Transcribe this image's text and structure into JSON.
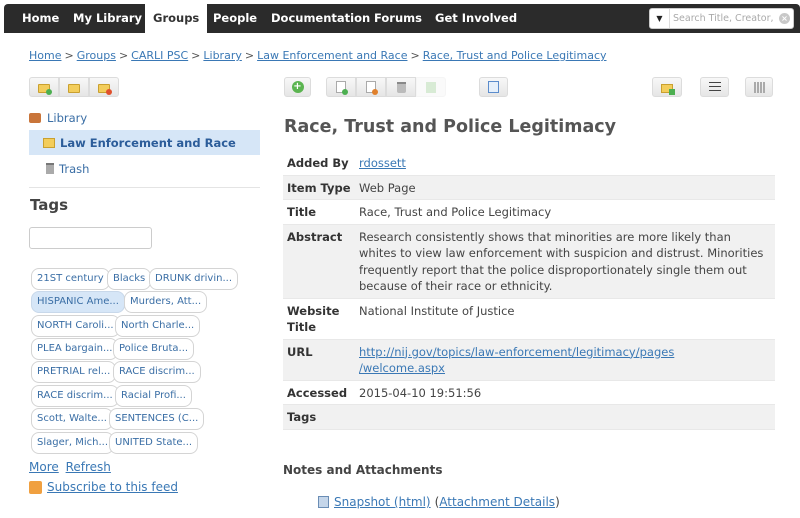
{
  "nav": {
    "items": [
      {
        "label": "Home",
        "active": false
      },
      {
        "label": "My Library",
        "active": false
      },
      {
        "label": "Groups",
        "active": true
      },
      {
        "label": "People",
        "active": false
      },
      {
        "label": "Documentation",
        "active": false
      },
      {
        "label": "Forums",
        "active": false
      },
      {
        "label": "Get Involved",
        "active": false
      }
    ],
    "search": {
      "placeholder": "Search Title, Creator, Year",
      "dropdown_icon": "caret-down-icon",
      "clear_icon": "clear-icon",
      "dropdown_glyph": "▼",
      "clear_glyph": "×"
    }
  },
  "breadcrumb": {
    "items": [
      "Home",
      "Groups",
      "CARLI PSC",
      "Library",
      "Law Enforcement and Race",
      "Race, Trust and Police Legitimacy"
    ],
    "separator": ">"
  },
  "toolbar": {
    "collection_buttons": [
      "new-collection",
      "edit-collection",
      "delete-collection"
    ],
    "item_buttons": [
      "new-item",
      "add-attachment",
      "remove-from-collection",
      "trash-item",
      "restore-item",
      "edit-item"
    ],
    "right_buttons": [
      "export",
      "citation-list",
      "library-settings"
    ],
    "new_item_glyph": "+"
  },
  "sidebar": {
    "library": [
      {
        "label": "Library",
        "icon": "library-icon",
        "selected": false
      },
      {
        "label": "Law Enforcement and Race",
        "icon": "folder-icon",
        "selected": true
      },
      {
        "label": "Trash",
        "icon": "trash-icon",
        "selected": false
      }
    ],
    "tags_heading": "Tags",
    "tag_filter_value": "",
    "tags": [
      {
        "label": "21ST century",
        "selected": false
      },
      {
        "label": "Blacks",
        "selected": false
      },
      {
        "label": "DRUNK drivin...",
        "selected": false
      },
      {
        "label": "HISPANIC Ame...",
        "selected": true
      },
      {
        "label": "Murders, Att...",
        "selected": false
      },
      {
        "label": "NORTH Caroli...",
        "selected": false
      },
      {
        "label": "North Charle...",
        "selected": false
      },
      {
        "label": "PLEA bargain...",
        "selected": false
      },
      {
        "label": "Police Bruta...",
        "selected": false
      },
      {
        "label": "PRETRIAL rel...",
        "selected": false
      },
      {
        "label": "RACE discrim...",
        "selected": false
      },
      {
        "label": "RACE discrim...",
        "selected": false
      },
      {
        "label": "Racial Profi...",
        "selected": false
      },
      {
        "label": "Scott, Walte...",
        "selected": false
      },
      {
        "label": "SENTENCES (C...",
        "selected": false
      },
      {
        "label": "Slager, Mich...",
        "selected": false
      },
      {
        "label": "UNITED State...",
        "selected": false
      }
    ],
    "more_label": "More",
    "refresh_label": "Refresh",
    "subscribe_label": "Subscribe to this feed"
  },
  "item": {
    "title": "Race, Trust and Police Legitimacy",
    "fields": {
      "added_by": {
        "label": "Added By",
        "value": "rdossett"
      },
      "item_type": {
        "label": "Item Type",
        "value": "Web Page"
      },
      "title": {
        "label": "Title",
        "value": "Race, Trust and Police Legitimacy"
      },
      "abstract": {
        "label": "Abstract",
        "value": "Research consistently shows that minorities are more likely than whites to view law enforcement with suspicion and distrust. Minorities frequently report that the police disproportionately single them out because of their race or ethnicity."
      },
      "website_title": {
        "label": "Website Title",
        "value": "National Institute of Justice"
      },
      "url": {
        "label": "URL",
        "value": "http://nij.gov/topics/law-enforcement/legitimacy/pages/welcome.aspx",
        "line1": "http://nij.gov/topics/law-enforcement/legitimacy/pages",
        "line2": "/welcome.aspx"
      },
      "accessed": {
        "label": "Accessed",
        "value": "2015-04-10 19:51:56"
      },
      "tags": {
        "label": "Tags",
        "value": ""
      }
    },
    "notes_heading": "Notes and Attachments",
    "attachment": {
      "label": "Snapshot (html)",
      "open_paren": "(",
      "details_label": "Attachment Details",
      "close_paren": ")"
    }
  },
  "colors": {
    "nav_bg": "#2b2b2b",
    "link": "#3a78b5",
    "selected_bg": "#d6e6f7",
    "row_shade": "#f1f1f1"
  }
}
